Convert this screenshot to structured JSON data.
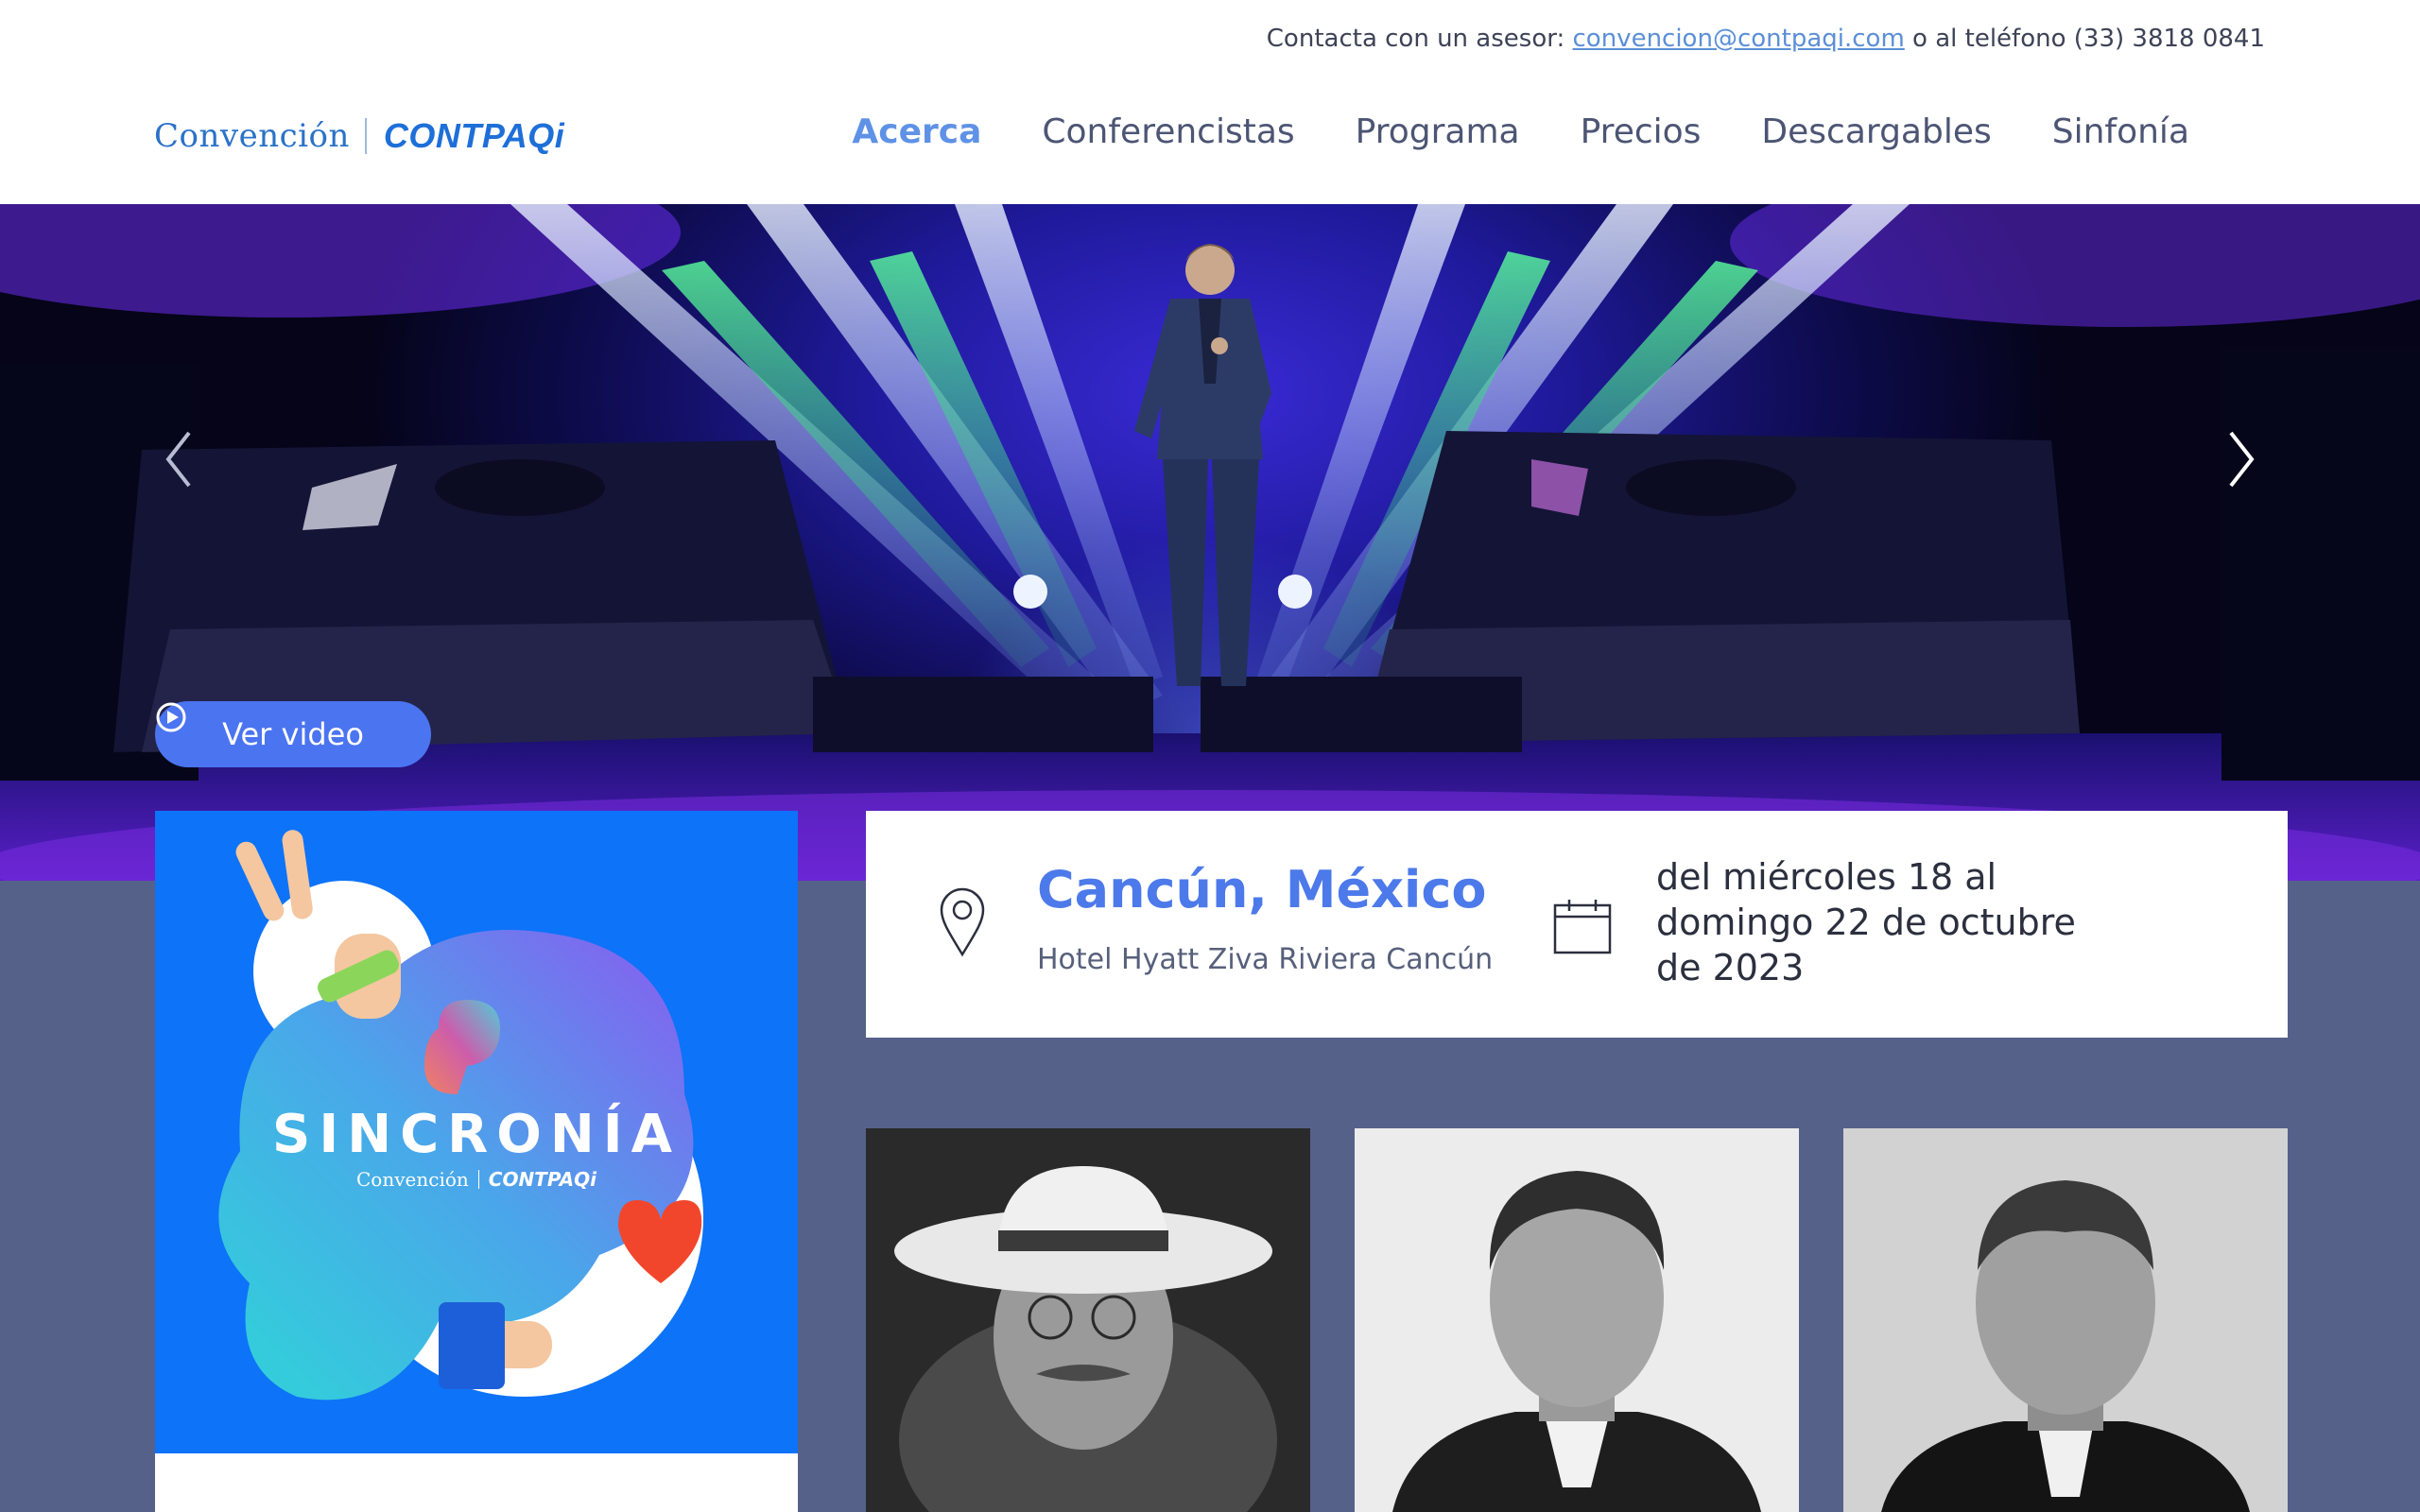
{
  "topbar": {
    "contact_prefix": "Contacta con un asesor: ",
    "contact_email": "convencion@contpaqi.com",
    "contact_suffix": " o al teléfono (33) 3818 0841"
  },
  "logo": {
    "convention": "Convención",
    "brand": "CONTPAQi"
  },
  "nav": {
    "items": [
      {
        "label": "Acerca",
        "active": true
      },
      {
        "label": "Conferencistas",
        "active": false
      },
      {
        "label": "Programa",
        "active": false
      },
      {
        "label": "Precios",
        "active": false
      },
      {
        "label": "Descargables",
        "active": false
      },
      {
        "label": "Sinfonía",
        "active": false
      }
    ]
  },
  "hero": {
    "video_button": "Ver video",
    "prev_icon": "chevron-left-icon",
    "next_icon": "chevron-right-icon"
  },
  "poster": {
    "title": "SINCRONÍA",
    "sub_convention": "Convención",
    "sub_brand": "CONTPAQi"
  },
  "event": {
    "city": "Cancún, México",
    "venue": "Hotel Hyatt Ziva Riviera Cancún",
    "dates": "del miércoles 18 al domingo 22 de octubre de 2023",
    "location_icon": "map-pin-icon",
    "date_icon": "calendar-icon"
  },
  "colors": {
    "accent": "#4d7aea",
    "nav_active": "#5f92e6",
    "button": "#4b74f1",
    "section_bg": "#56618a",
    "poster_bg": "#0d73f8"
  }
}
